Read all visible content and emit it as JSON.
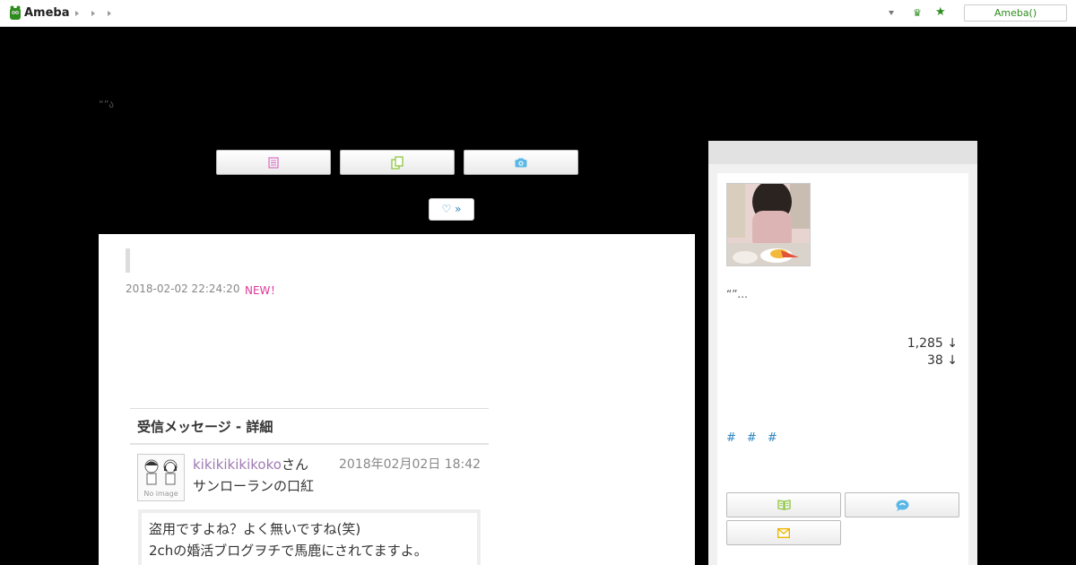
{
  "header": {
    "logo_text": "Ameba",
    "login_label": "Ameba()"
  },
  "blog": {
    "description": "“”ა",
    "follow_label": "♡ »"
  },
  "article": {
    "date": "2018-02-02 22:24:20",
    "new_badge": "NEW！",
    "image": {
      "header": "受信メッセージ - 詳細",
      "avatar_label": "No image",
      "sender": "kikikikikikoko",
      "sender_suffix": "さん",
      "sent_at": "2018年02月02日 18:42",
      "subject": "サンローランの口紅",
      "body_line1": "盗用ですよね？よく無いですね(笑)",
      "body_line2": "2chの婚活ブログヲチで馬鹿にされてますよ。"
    }
  },
  "sidebar": {
    "profile_desc": "“”...",
    "stat1": "1,285 ↓",
    "stat2": "38 ↓",
    "tags": [
      "#",
      "#",
      "#"
    ]
  },
  "colors": {
    "accent_green": "#2d8c1d",
    "link_blue": "#2e86c1",
    "new_pink": "#e0369b"
  },
  "icons": {
    "nav": [
      "document-icon",
      "copy-icon",
      "camera-icon"
    ],
    "sidebar": [
      "book-icon",
      "chat-icon",
      "mail-icon"
    ]
  }
}
